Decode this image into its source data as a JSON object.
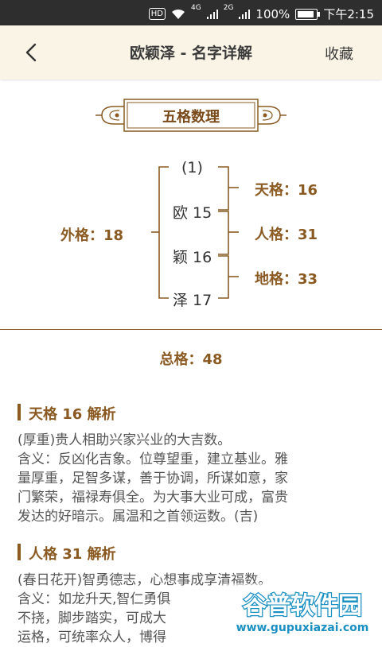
{
  "statusbar": {
    "hd": "HD",
    "net1": "4G",
    "net2": "2G",
    "battery": "100%",
    "time": "下午2:15"
  },
  "topbar": {
    "title": "欧颖泽 - 名字详解",
    "collect": "收藏"
  },
  "wuge": {
    "section_title": "五格数理",
    "top": "(1)",
    "chars": [
      {
        "text": "欧 15"
      },
      {
        "text": "颖 16"
      },
      {
        "text": "泽 17"
      }
    ],
    "tian": "天格：16",
    "ren": "人格：31",
    "di": "地格：33",
    "wai": "外格：18",
    "zong": "总格：48"
  },
  "analysis": [
    {
      "heading": "天格 16 解析",
      "lines": [
        "(厚重)贵人相助兴家兴业的大吉数。",
        "含义：反凶化吉象。位尊望重，建立基业。雅",
        "量厚重，足智多谋，善于协调，所谋如意，家",
        "门繁荣，福禄寿俱全。为大事大业可成，富贵",
        "发达的好暗示。属温和之首领运数。(吉)"
      ]
    },
    {
      "heading": "人格 31 解析",
      "lines": [
        "(春日花开)智勇德志，心想事成享清福数。",
        "含义：如龙升天,智仁勇俱",
        "不挠，脚步踏实，可成大",
        "运格，可统率众人，博得"
      ]
    }
  ],
  "watermark": {
    "brand": "谷普软件园",
    "url": "www.gupuxiazai.com"
  },
  "colors": {
    "accent": "#8a5a22",
    "topbar_bg": "#faf4e6"
  }
}
